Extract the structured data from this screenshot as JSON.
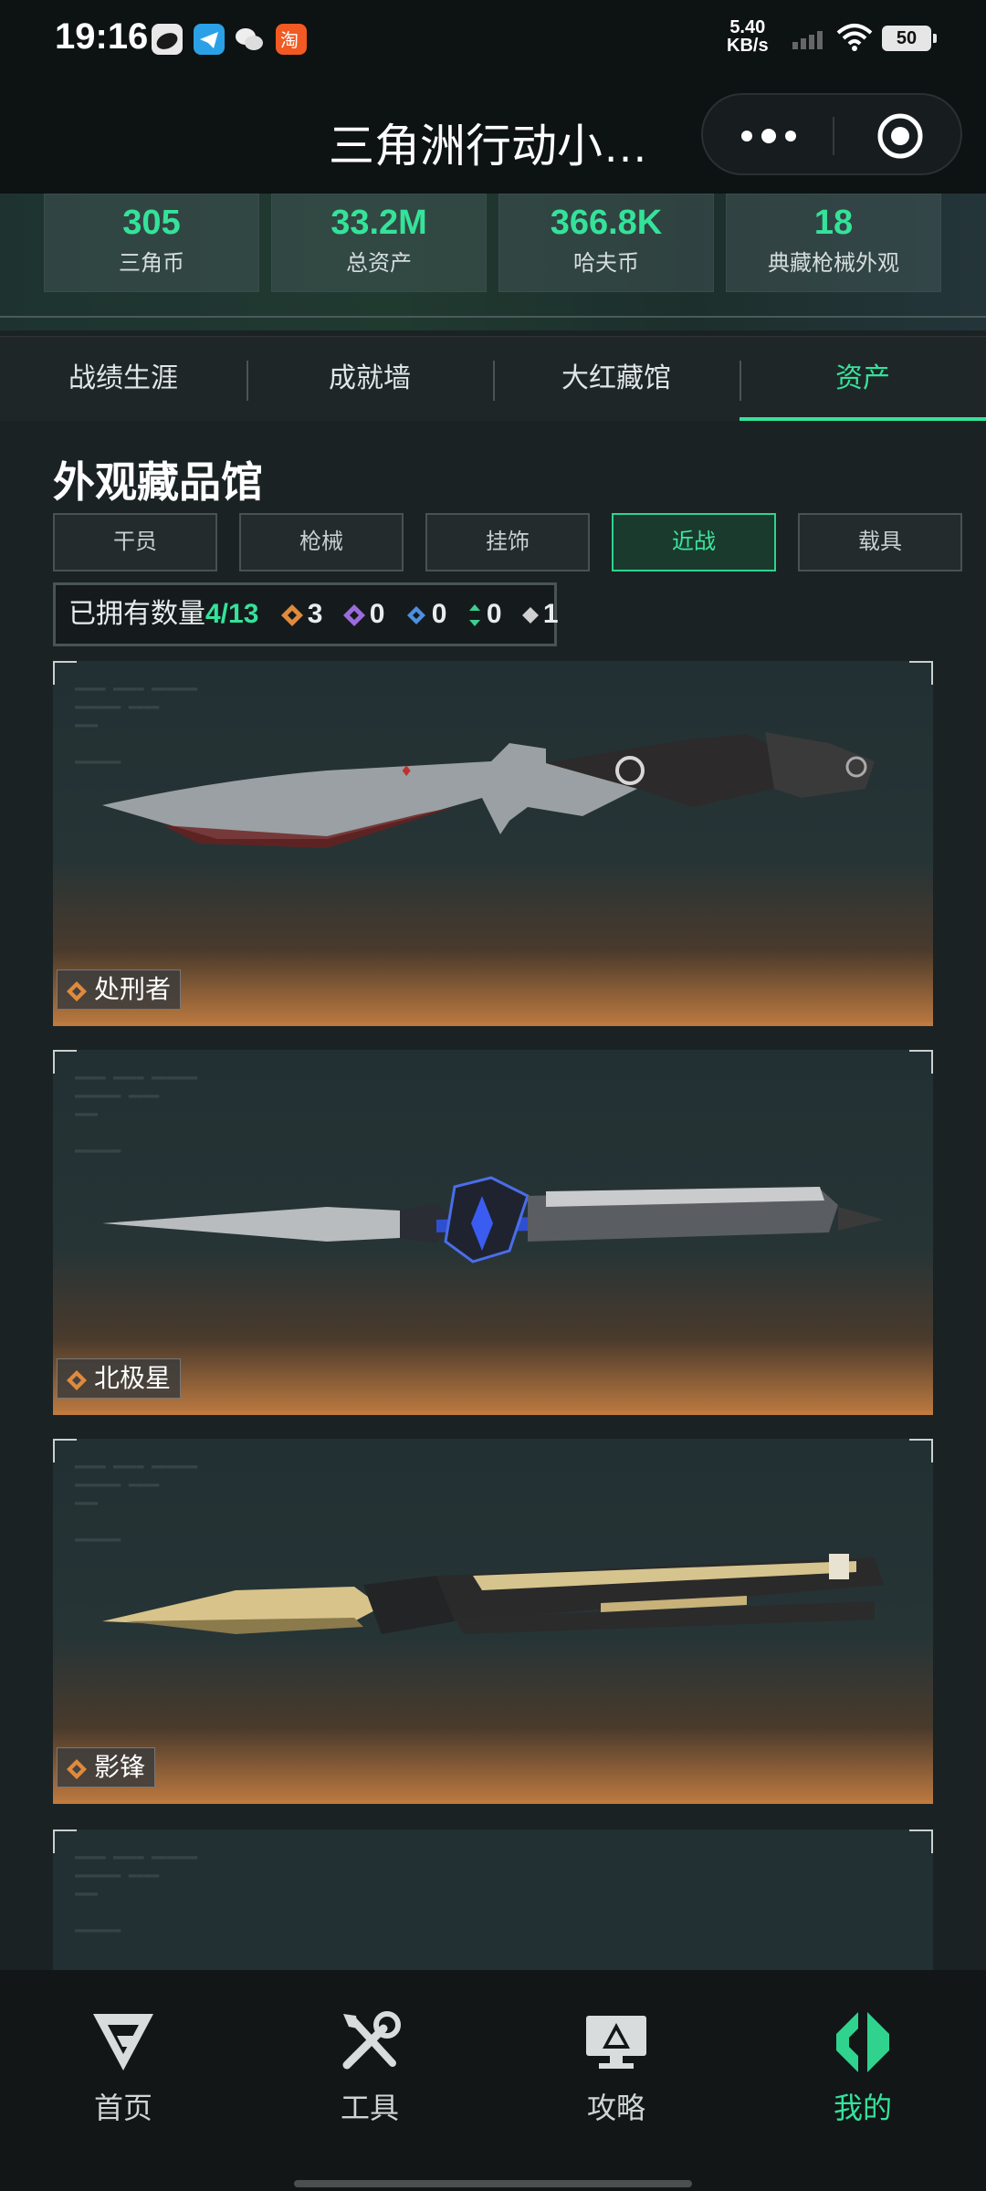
{
  "status_bar": {
    "time": "19:16",
    "net_speed_value": "5.40",
    "net_speed_unit": "KB/s",
    "battery": "50",
    "app_icons": [
      "weibo-icon",
      "telegram-icon",
      "wechat-icon",
      "taobao-icon"
    ]
  },
  "header": {
    "title": "三角洲行动小…"
  },
  "stats": [
    {
      "value": "305",
      "label": "三角币"
    },
    {
      "value": "33.2M",
      "label": "总资产"
    },
    {
      "value": "366.8K",
      "label": "哈夫币"
    },
    {
      "value": "18",
      "label": "典藏枪械外观"
    }
  ],
  "tabs": [
    {
      "label": "战绩生涯",
      "active": false
    },
    {
      "label": "成就墙",
      "active": false
    },
    {
      "label": "大红藏馆",
      "active": false
    },
    {
      "label": "资产",
      "active": true
    }
  ],
  "section": {
    "title": "外观藏品馆",
    "filters": [
      "干员",
      "枪械",
      "挂饰",
      "近战",
      "载具"
    ],
    "active_filter": "近战"
  },
  "owned": {
    "label": "已拥有数量",
    "value": "4/13",
    "rarity_counts": [
      "3",
      "0",
      "0",
      "0",
      "1"
    ]
  },
  "cards": [
    {
      "name": "处刑者"
    },
    {
      "name": "北极星"
    },
    {
      "name": "影锋"
    }
  ],
  "bottom_nav": [
    {
      "label": "首页",
      "icon": "home-logo-icon",
      "active": false
    },
    {
      "label": "工具",
      "icon": "tools-icon",
      "active": false
    },
    {
      "label": "攻略",
      "icon": "guide-monitor-icon",
      "active": false
    },
    {
      "label": "我的",
      "icon": "profile-logo-icon",
      "active": true
    }
  ],
  "colors": {
    "accent": "#35e29a",
    "rarity_orange": "#e08a3c",
    "rarity_purple": "#9b6bdc",
    "rarity_blue": "#4e8fe0",
    "rarity_green": "#3ccf8e",
    "rarity_white": "#d0d0d0"
  }
}
